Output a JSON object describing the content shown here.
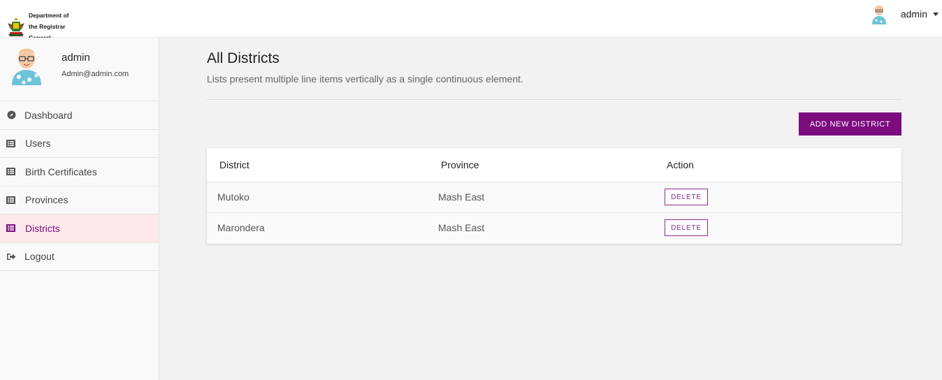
{
  "header": {
    "brand_lines": [
      "Department of",
      "the Registrar",
      "General"
    ],
    "user_name": "admin"
  },
  "sidebar": {
    "profile": {
      "name": "admin",
      "email": "Admin@admin.com"
    },
    "items": [
      {
        "label": "Dashboard",
        "icon": "compass-icon",
        "active": false
      },
      {
        "label": "Users",
        "icon": "list-icon",
        "active": false
      },
      {
        "label": "Birth Certificates",
        "icon": "list-icon",
        "active": false
      },
      {
        "label": "Provinces",
        "icon": "list-icon",
        "active": false
      },
      {
        "label": "Districts",
        "icon": "list-icon",
        "active": true
      },
      {
        "label": "Logout",
        "icon": "sign-out-icon",
        "active": false
      }
    ]
  },
  "main": {
    "title": "All Districts",
    "subtitle": "Lists present multiple line items vertically as a single continuous element.",
    "add_button": "ADD NEW DISTRICT",
    "table": {
      "headers": [
        "District",
        "Province",
        "Action"
      ],
      "rows": [
        {
          "district": "Mutoko",
          "province": "Mash East",
          "action": "DELETE"
        },
        {
          "district": "Marondera",
          "province": "Mash East",
          "action": "DELETE"
        }
      ]
    }
  },
  "colors": {
    "accent": "#7b0c7e",
    "active_bg": "#fde9ea"
  }
}
